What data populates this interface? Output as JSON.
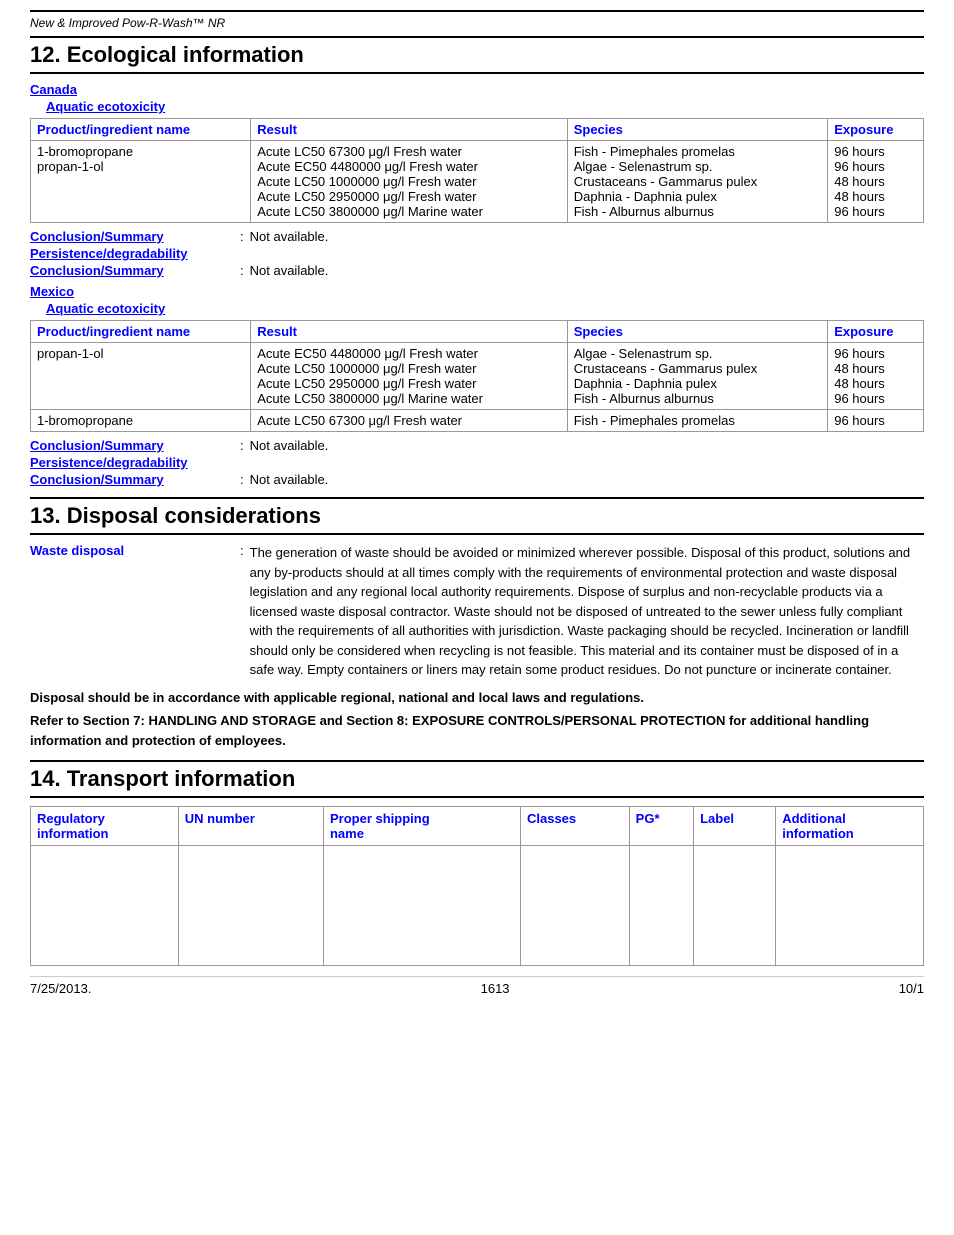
{
  "document": {
    "header": "New & Improved Pow-R-Wash™ NR",
    "footer_left": "7/25/2013.",
    "footer_center": "1613",
    "footer_right": "10/1"
  },
  "section12": {
    "title": "12. Ecological information",
    "canada": {
      "label": "Canada",
      "aquatic_label": "Aquatic ecotoxicity",
      "table_headers": [
        "Product/ingredient name",
        "Result",
        "Species",
        "Exposure"
      ],
      "table_rows": [
        {
          "ingredient": "1-bromopropane\npropan-1-ol",
          "result": "Acute LC50 67300 μg/l Fresh water\nAcute EC50 4480000 μg/l Fresh water\nAcute LC50 1000000 μg/l Fresh water\nAcute LC50 2950000 μg/l Fresh water\nAcute LC50 3800000 μg/l Marine water",
          "species": "Fish - Pimephales promelas\nAlgae - Selenastrum sp.\nCrustaceans - Gammarus pulex\nDaphnia - Daphnia pulex\nFish - Alburnus alburnus",
          "exposure": "96 hours\n96 hours\n48 hours\n48 hours\n96 hours"
        }
      ],
      "conclusion_label": "Conclusion/Summary",
      "conclusion_colon": ":",
      "conclusion_value": "Not available.",
      "persistence_label": "Persistence/degradability",
      "conclusion2_label": "Conclusion/Summary",
      "conclusion2_colon": ":",
      "conclusion2_value": "Not available."
    },
    "mexico": {
      "label": "Mexico",
      "aquatic_label": "Aquatic ecotoxicity",
      "table_headers": [
        "Product/ingredient name",
        "Result",
        "Species",
        "Exposure"
      ],
      "table_rows": [
        {
          "ingredient": "propan-1-ol",
          "result": "Acute EC50 4480000 μg/l Fresh water\nAcute LC50 1000000 μg/l Fresh water\nAcute LC50 2950000 μg/l Fresh water\nAcute LC50 3800000 μg/l Marine water",
          "species": "Algae - Selenastrum sp.\nCrustaceans - Gammarus pulex\nDaphnia - Daphnia pulex\nFish - Alburnus alburnus",
          "exposure": "96 hours\n48 hours\n48 hours\n96 hours"
        },
        {
          "ingredient": "1-bromopropane",
          "result": "Acute LC50 67300 μg/l Fresh water",
          "species": "Fish - Pimephales promelas",
          "exposure": "96 hours"
        }
      ],
      "conclusion_label": "Conclusion/Summary",
      "conclusion_colon": ":",
      "conclusion_value": "Not available.",
      "persistence_label": "Persistence/degradability",
      "conclusion2_label": "Conclusion/Summary",
      "conclusion2_colon": ":",
      "conclusion2_value": "Not available."
    }
  },
  "section13": {
    "title": "13. Disposal considerations",
    "waste_label": "Waste disposal",
    "waste_colon": ":",
    "waste_text": "The generation of waste should be avoided or minimized wherever possible.  Disposal of this product, solutions and any by-products should at all times comply with the requirements of environmental protection and waste disposal legislation and any regional local authority requirements.  Dispose of surplus and non-recyclable products via a licensed waste disposal contractor.  Waste should not be disposed of untreated to the sewer unless fully compliant with the requirements of all authorities with jurisdiction.  Waste packaging should be recycled.  Incineration or landfill should only be considered when recycling is not feasible.  This material and its container must be disposed of in a safe way.  Empty containers or liners may retain some product residues.  Do not puncture or incinerate container.",
    "bold_para1": "Disposal should be in accordance with applicable regional, national and local laws and regulations.",
    "bold_para2": "Refer to Section 7: HANDLING AND STORAGE and Section 8: EXPOSURE CONTROLS/PERSONAL PROTECTION for additional handling information and protection of employees."
  },
  "section14": {
    "title": "14. Transport information",
    "table_headers": [
      "Regulatory\ninformation",
      "UN number",
      "Proper shipping\nname",
      "Classes",
      "PG*",
      "Label",
      "Additional\ninformation"
    ],
    "table_rows": []
  }
}
